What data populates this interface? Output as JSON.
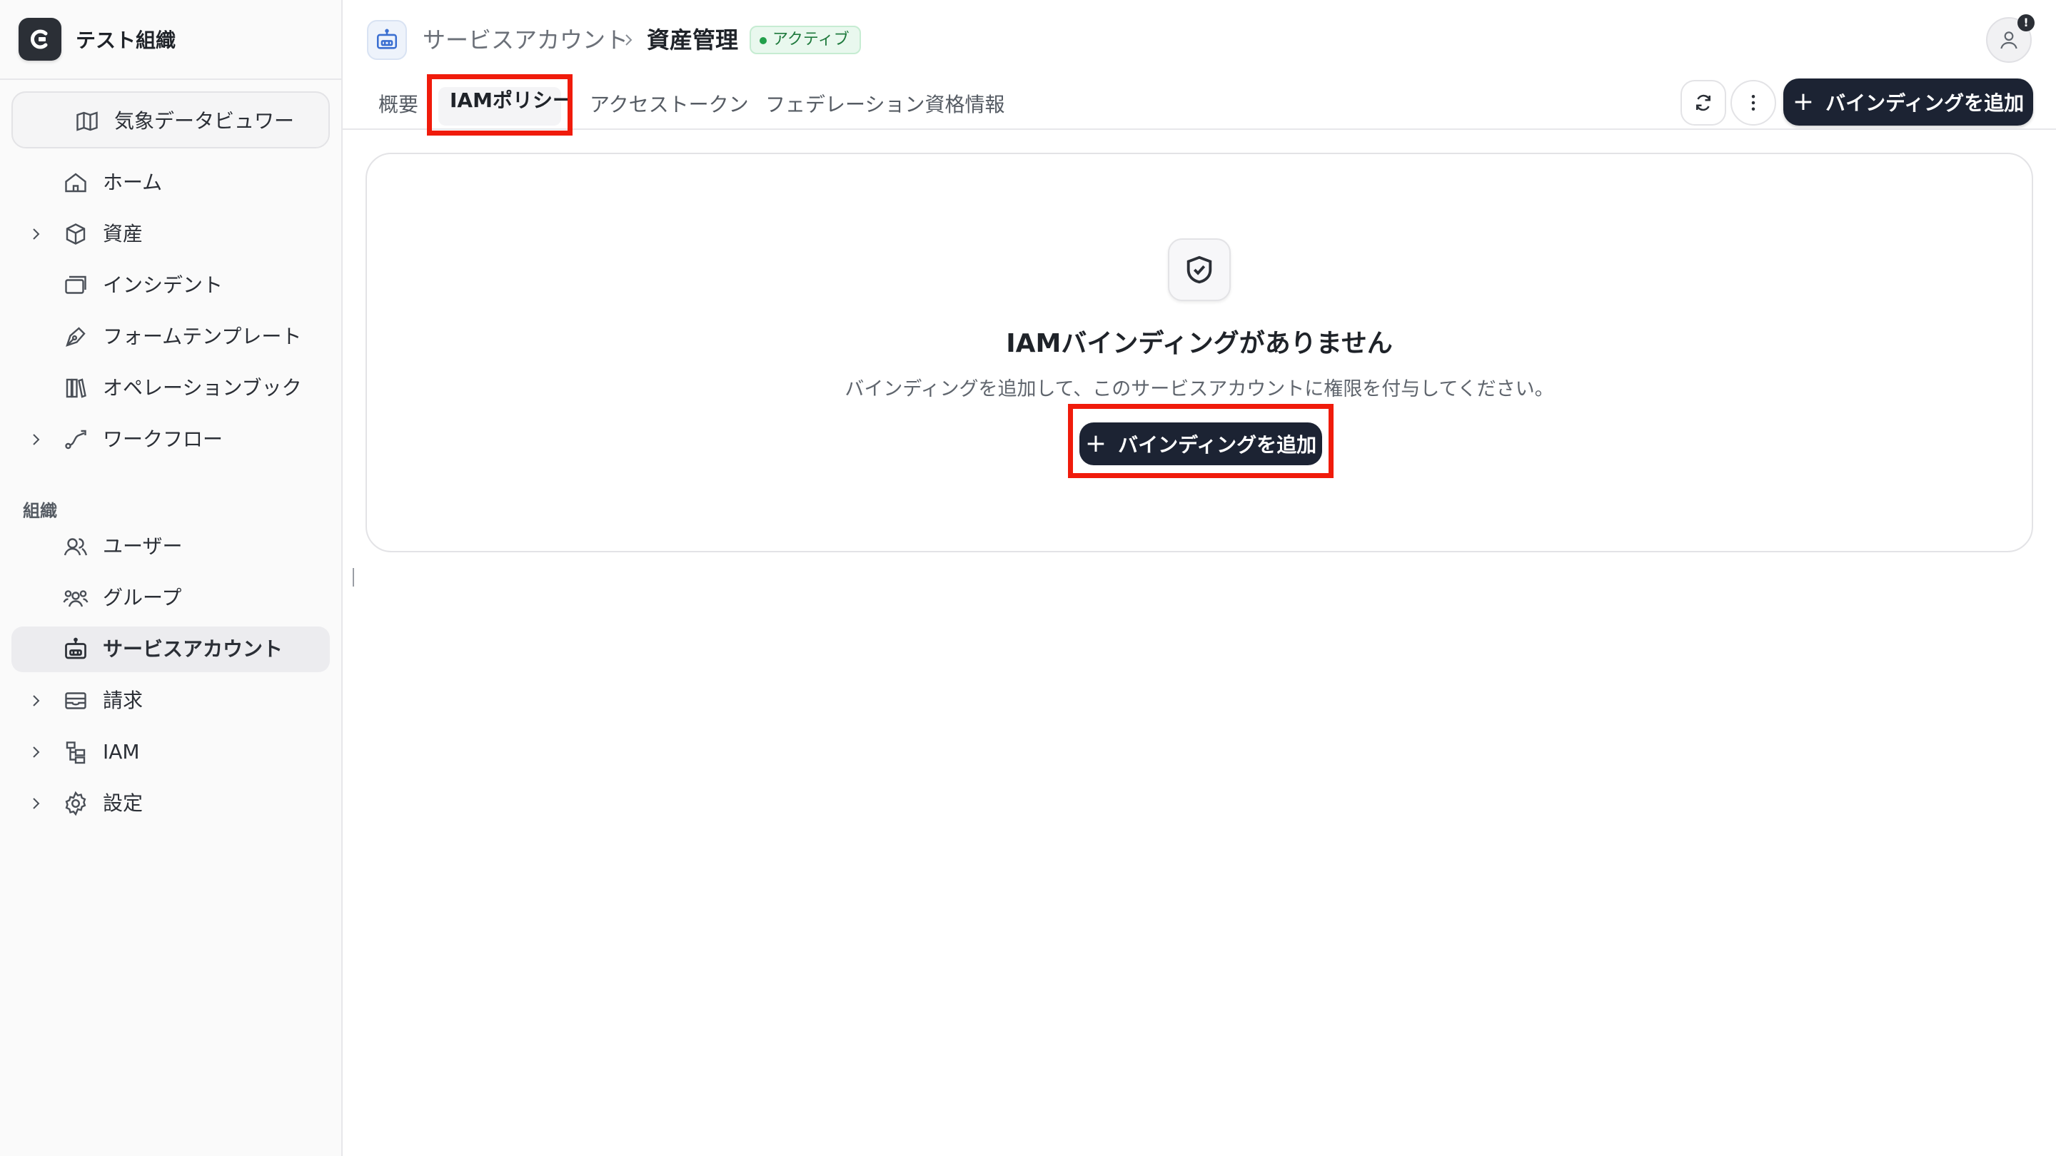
{
  "org": {
    "name": "テスト組織"
  },
  "sidebar": {
    "project": "気象データビュワー",
    "items": [
      {
        "label": "ホーム"
      },
      {
        "label": "資産"
      },
      {
        "label": "インシデント"
      },
      {
        "label": "フォームテンプレート"
      },
      {
        "label": "オペレーションブック"
      },
      {
        "label": "ワークフロー"
      }
    ],
    "section_label": "組織",
    "org_items": [
      {
        "label": "ユーザー"
      },
      {
        "label": "グループ"
      },
      {
        "label": "サービスアカウント"
      },
      {
        "label": "請求"
      },
      {
        "label": "IAM"
      },
      {
        "label": "設定"
      }
    ]
  },
  "header": {
    "breadcrumb_parent": "サービスアカウント",
    "breadcrumb_current": "資産管理",
    "status": "アクティブ",
    "avatar_badge": "!"
  },
  "tabs": [
    {
      "label": "概要"
    },
    {
      "label": "IAMポリシー"
    },
    {
      "label": "アクセストークン"
    },
    {
      "label": "フェデレーション資格情報"
    }
  ],
  "toolbar": {
    "add_binding": "バインディングを追加"
  },
  "empty_state": {
    "title": "IAMバインディングがありません",
    "description": "バインディングを追加して、このサービスアカウントに権限を付与してください。",
    "button": "バインディングを追加"
  },
  "colors": {
    "primary": "#1c2333",
    "highlight": "#f01b0b",
    "status_green": "#22a04b"
  }
}
